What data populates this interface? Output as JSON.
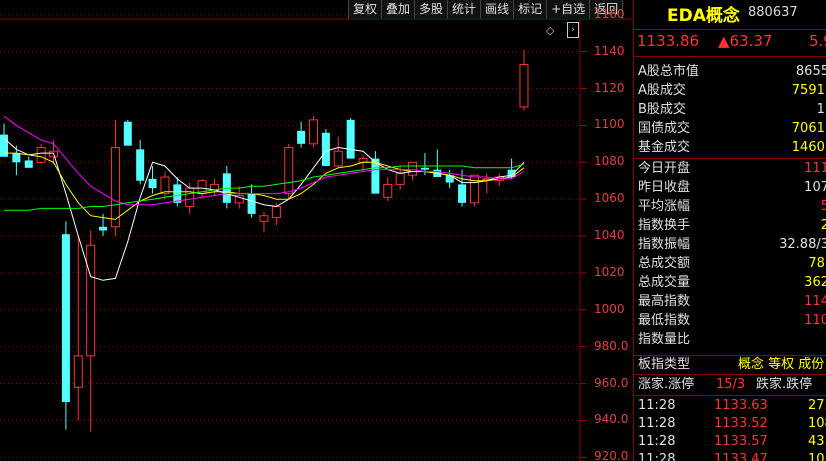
{
  "toolbar": {
    "items": [
      "复权",
      "叠加",
      "多股",
      "统计",
      "画线",
      "标记",
      "+自选",
      "返回"
    ]
  },
  "chart_data": {
    "type": "candlestick",
    "y_ticks": [
      "1160",
      "1140",
      "1120",
      "1100",
      "1080",
      "1060",
      "1040",
      "1020",
      "1000",
      "980.0",
      "960.0",
      "940.0",
      "920.0"
    ],
    "ylim": [
      918,
      1168
    ],
    "up_color": "#ff3232",
    "down_color": "#54ffff",
    "candles": [
      {
        "o": 1095,
        "h": 1101,
        "l": 1083,
        "c": 1083
      },
      {
        "o": 1085,
        "h": 1089,
        "l": 1073,
        "c": 1080
      },
      {
        "o": 1081,
        "h": 1083,
        "l": 1077,
        "c": 1077
      },
      {
        "o": 1080,
        "h": 1090,
        "l": 1079,
        "c": 1088
      },
      {
        "o": 1083,
        "h": 1092,
        "l": 1079,
        "c": 1086
      },
      {
        "o": 1041,
        "h": 1048,
        "l": 935,
        "c": 950
      },
      {
        "o": 958,
        "h": 1040,
        "l": 940,
        "c": 975
      },
      {
        "o": 975,
        "h": 1043,
        "l": 934,
        "c": 1035
      },
      {
        "o": 1045,
        "h": 1052,
        "l": 1040,
        "c": 1043
      },
      {
        "o": 1045,
        "h": 1103,
        "l": 1040,
        "c": 1088
      },
      {
        "o": 1102,
        "h": 1103,
        "l": 1089,
        "c": 1089
      },
      {
        "o": 1087,
        "h": 1092,
        "l": 1068,
        "c": 1070
      },
      {
        "o": 1071,
        "h": 1078,
        "l": 1063,
        "c": 1066
      },
      {
        "o": 1063,
        "h": 1075,
        "l": 1060,
        "c": 1072
      },
      {
        "o": 1068,
        "h": 1072,
        "l": 1056,
        "c": 1058
      },
      {
        "o": 1056,
        "h": 1069,
        "l": 1052,
        "c": 1066
      },
      {
        "o": 1063,
        "h": 1071,
        "l": 1060,
        "c": 1070
      },
      {
        "o": 1065,
        "h": 1071,
        "l": 1062,
        "c": 1068
      },
      {
        "o": 1074,
        "h": 1078,
        "l": 1055,
        "c": 1058
      },
      {
        "o": 1058,
        "h": 1067,
        "l": 1055,
        "c": 1062
      },
      {
        "o": 1063,
        "h": 1068,
        "l": 1050,
        "c": 1052
      },
      {
        "o": 1048,
        "h": 1053,
        "l": 1042,
        "c": 1051
      },
      {
        "o": 1050,
        "h": 1058,
        "l": 1046,
        "c": 1056
      },
      {
        "o": 1063,
        "h": 1090,
        "l": 1060,
        "c": 1088
      },
      {
        "o": 1097,
        "h": 1102,
        "l": 1088,
        "c": 1090
      },
      {
        "o": 1090,
        "h": 1105,
        "l": 1088,
        "c": 1103
      },
      {
        "o": 1096,
        "h": 1098,
        "l": 1080,
        "c": 1078
      },
      {
        "o": 1078,
        "h": 1094,
        "l": 1077,
        "c": 1086
      },
      {
        "o": 1103,
        "h": 1104,
        "l": 1082,
        "c": 1082
      },
      {
        "o": 1080,
        "h": 1084,
        "l": 1075,
        "c": 1082
      },
      {
        "o": 1082,
        "h": 1086,
        "l": 1063,
        "c": 1063
      },
      {
        "o": 1061,
        "h": 1072,
        "l": 1059,
        "c": 1068
      },
      {
        "o": 1068,
        "h": 1078,
        "l": 1065,
        "c": 1074
      },
      {
        "o": 1073,
        "h": 1080,
        "l": 1070,
        "c": 1080
      },
      {
        "o": 1077,
        "h": 1085,
        "l": 1073,
        "c": 1076
      },
      {
        "o": 1076,
        "h": 1087,
        "l": 1072,
        "c": 1072
      },
      {
        "o": 1073,
        "h": 1076,
        "l": 1066,
        "c": 1069
      },
      {
        "o": 1068,
        "h": 1076,
        "l": 1056,
        "c": 1058
      },
      {
        "o": 1058,
        "h": 1073,
        "l": 1056,
        "c": 1073
      },
      {
        "o": 1071,
        "h": 1074,
        "l": 1063,
        "c": 1071
      },
      {
        "o": 1070,
        "h": 1074,
        "l": 1067,
        "c": 1072
      },
      {
        "o": 1076,
        "h": 1082,
        "l": 1071,
        "c": 1072
      },
      {
        "o": 1110,
        "h": 1141,
        "l": 1108,
        "c": 1133
      }
    ],
    "ma_lines": [
      {
        "color": "#ffffff",
        "values": [
          1093,
          1087,
          1084,
          1085,
          1085,
          1063,
          1040,
          1018,
          1016,
          1017,
          1037,
          1061,
          1080,
          1078,
          1071,
          1066,
          1066,
          1065,
          1063,
          1061,
          1059,
          1057,
          1056,
          1060,
          1068,
          1077,
          1086,
          1088,
          1087,
          1086,
          1080,
          1076,
          1074,
          1075,
          1075,
          1074,
          1073,
          1069,
          1069,
          1070,
          1072,
          1073,
          1080
        ]
      },
      {
        "color": "#ffff00",
        "values": [
          1085,
          1085,
          1084,
          1083,
          1080,
          1068,
          1058,
          1051,
          1050,
          1049,
          1054,
          1059,
          1062,
          1064,
          1064,
          1064,
          1063,
          1064,
          1064,
          1063,
          1063,
          1062,
          1060,
          1060,
          1063,
          1068,
          1074,
          1077,
          1078,
          1080,
          1080,
          1078,
          1076,
          1075,
          1075,
          1074,
          1073,
          1071,
          1070,
          1070,
          1071,
          1072,
          1077
        ]
      },
      {
        "color": "#ff00ff",
        "values": [
          1105,
          1100,
          1096,
          1092,
          1090,
          1082,
          1074,
          1067,
          1063,
          1059,
          1057,
          1057,
          1057,
          1058,
          1059,
          1060,
          1061,
          1062,
          1063,
          1063,
          1063,
          1063,
          1063,
          1064,
          1066,
          1069,
          1072,
          1073,
          1074,
          1075,
          1076,
          1076,
          1076,
          1076,
          1075,
          1075,
          1074,
          1073,
          1072,
          1072,
          1071,
          1071,
          1075
        ]
      },
      {
        "color": "#00ff00",
        "values": [
          1054,
          1054,
          1054,
          1055,
          1055,
          1055,
          1055,
          1056,
          1056,
          1057,
          1058,
          1059,
          1060,
          1061,
          1062,
          1063,
          1064,
          1065,
          1066,
          1066,
          1067,
          1067,
          1068,
          1069,
          1070,
          1072,
          1073,
          1074,
          1075,
          1076,
          1077,
          1077,
          1078,
          1078,
          1078,
          1078,
          1078,
          1078,
          1077,
          1077,
          1077,
          1077,
          1079
        ]
      }
    ]
  },
  "side": {
    "name": "EDA概念",
    "code": "880637",
    "last": "1133.86",
    "change": "▲63.37",
    "pct": "5.9",
    "stats": [
      {
        "label": "A股总市值",
        "value": "8655",
        "color": "#e0e0e0"
      },
      {
        "label": "A股成交",
        "value": "7591.",
        "color": "#ffff00"
      },
      {
        "label": "B股成交",
        "value": "1.",
        "color": "#e0e0e0"
      },
      {
        "label": "国债成交",
        "value": "7061.",
        "color": "#ffff00"
      },
      {
        "label": "基金成交",
        "value": "1460.",
        "color": "#ffff00"
      },
      {
        "label": "今日开盘",
        "value": "111",
        "color": "#ff3232"
      },
      {
        "label": "昨日收盘",
        "value": "107",
        "color": "#e0e0e0"
      },
      {
        "label": "平均涨幅",
        "value": "5",
        "color": "#ff3232"
      },
      {
        "label": "指数换手",
        "value": "2",
        "color": "#ffff00"
      },
      {
        "label": "指数振幅",
        "value": "32.88/3",
        "color": "#e0e0e0"
      },
      {
        "label": "总成交额",
        "value": "78.",
        "color": "#ffff00"
      },
      {
        "label": "总成交量",
        "value": "362",
        "color": "#ffff00"
      },
      {
        "label": "最高指数",
        "value": "114",
        "color": "#ff3232"
      },
      {
        "label": "最低指数",
        "value": "110",
        "color": "#ff3232"
      },
      {
        "label": "指数量比",
        "value": "",
        "color": "#e0e0e0"
      }
    ],
    "board": {
      "label": "板指类型",
      "value": "概念 等权 成份"
    },
    "limits": {
      "up_label": "涨家.涨停",
      "up_value": "15/3",
      "down_label": "跌家.跌停"
    },
    "ticks": [
      {
        "time": "11:28",
        "price": "1133.63",
        "vol": "27."
      },
      {
        "time": "11:28",
        "price": "1133.52",
        "vol": "108"
      },
      {
        "time": "11:28",
        "price": "1133.57",
        "vol": "43."
      },
      {
        "time": "11:28",
        "price": "1133.47",
        "vol": "10"
      }
    ]
  }
}
